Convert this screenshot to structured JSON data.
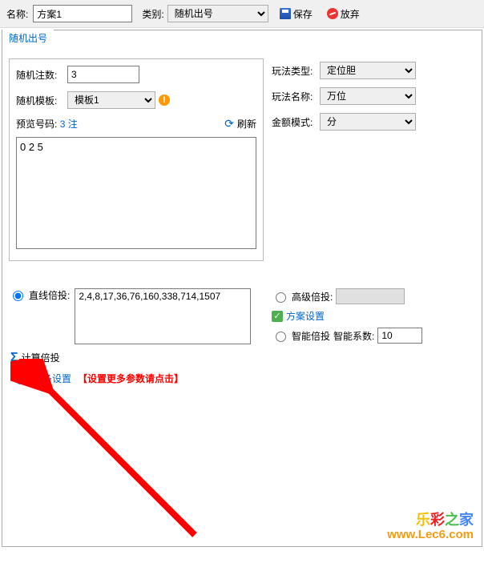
{
  "header": {
    "name_label": "名称:",
    "name_value": "方案1",
    "category_label": "类别:",
    "category_value": "随机出号",
    "save_label": "保存",
    "discard_label": "放弃"
  },
  "tab_label": "随机出号",
  "left": {
    "count_label": "随机注数:",
    "count_value": "3",
    "template_label": "随机模板:",
    "template_value": "模板1",
    "preview_label": "预览号码:",
    "preview_count_link": "3 注",
    "refresh_label": "刷新",
    "preview_content": "0 2 5"
  },
  "right": {
    "play_type_label": "玩法类型:",
    "play_type_value": "定位胆",
    "play_name_label": "玩法名称:",
    "play_name_value": "万位",
    "amount_mode_label": "金额模式:",
    "amount_mode_value": "分"
  },
  "bet": {
    "linear_label": "直线倍投:",
    "linear_value": "2,4,8,17,36,76,160,338,714,1507",
    "calc_label": "计算倍投",
    "advanced_label": "高级倍投:",
    "plan_settings_label": "方案设置",
    "smart_label": "智能倍投",
    "smart_coef_label": "智能系数:",
    "smart_coef_value": "10"
  },
  "more": {
    "link_label": "更多设置",
    "hint": "【设置更多参数请点击】"
  },
  "watermark": {
    "line1": "乐彩之家",
    "line2": "www.Lec6.com"
  }
}
